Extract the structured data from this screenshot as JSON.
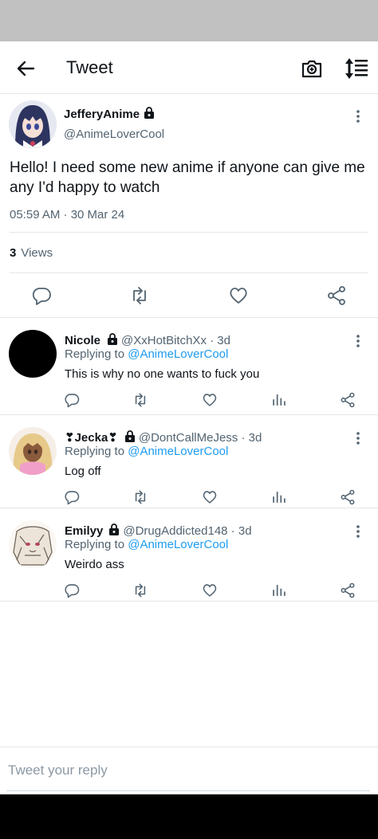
{
  "header": {
    "title": "Tweet",
    "back_icon": "arrow-left-icon",
    "camera_icon": "camera-icon",
    "sort_icon": "sort-icon"
  },
  "tweet": {
    "name": "JefferyAnime",
    "handle": "@AnimeLoverCool",
    "text": "Hello! I need some new anime if anyone can give me any I'd happy to watch",
    "timestamp": "05:59 AM · 30 Mar 24",
    "views_count": "3",
    "views_label": "Views"
  },
  "replies": [
    {
      "name": "Nicole",
      "handle": "@XxHotBitchXx · 3d",
      "replying_prefix": "Replying to",
      "replying_to": "@AnimeLoverCool",
      "text": "This is why no one wants to fuck you"
    },
    {
      "name": "❣Jecka❣",
      "handle": "@DontCallMeJess · 3d",
      "replying_prefix": "Replying to",
      "replying_to": "@AnimeLoverCool",
      "text": "Log off"
    },
    {
      "name": "Emilyy",
      "handle": "@DrugAddicted148 · 3d",
      "replying_prefix": "Replying to",
      "replying_to": "@AnimeLoverCool",
      "text": "Weirdo ass"
    }
  ],
  "reply_input": {
    "placeholder": "Tweet your reply"
  },
  "colors": {
    "accent": "#1d9bf0",
    "secondary_text": "#536471",
    "status_bar": "#c1c1c1",
    "nav_bar": "#000000"
  }
}
